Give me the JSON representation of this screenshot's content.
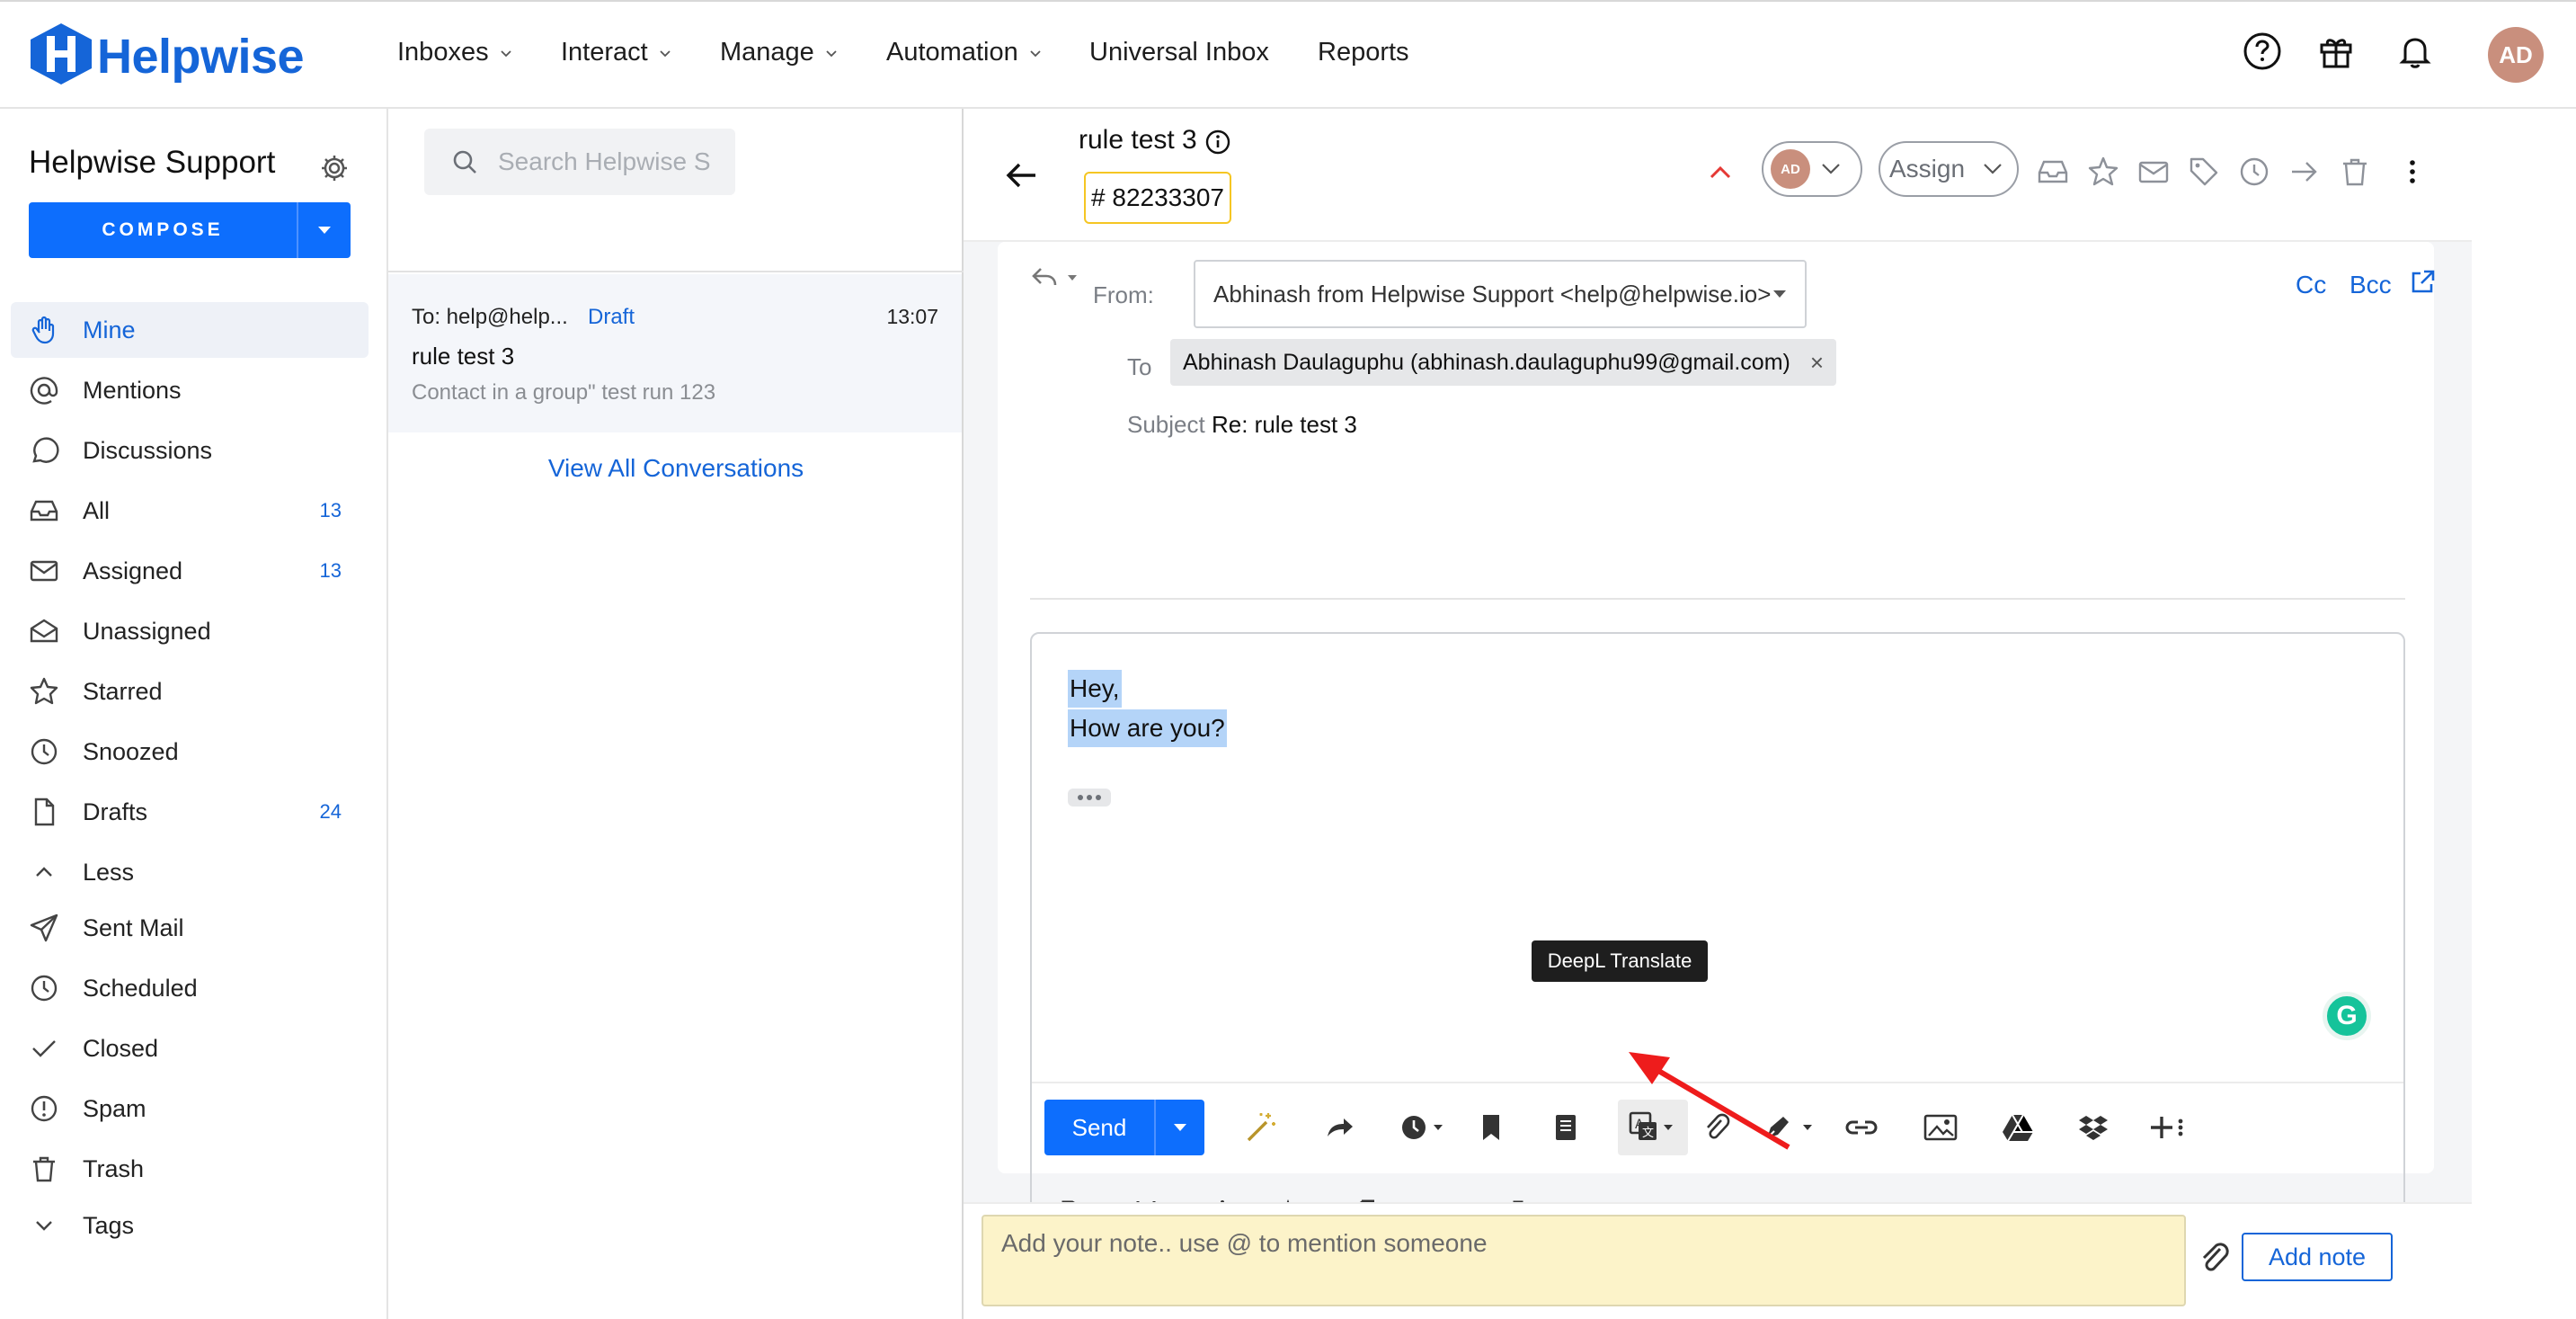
{
  "brand": {
    "name": "Helpwise",
    "accent": "#1565d8",
    "primary_button": "#0d6efd"
  },
  "nav": {
    "items": [
      {
        "label": "Inboxes",
        "dropdown": true
      },
      {
        "label": "Interact",
        "dropdown": true
      },
      {
        "label": "Manage",
        "dropdown": true
      },
      {
        "label": "Automation",
        "dropdown": true
      },
      {
        "label": "Universal Inbox",
        "dropdown": false
      },
      {
        "label": "Reports",
        "dropdown": false
      }
    ],
    "icons": [
      "help-circle-icon",
      "gift-icon",
      "bell-icon"
    ],
    "avatar": "AD"
  },
  "sidebar": {
    "workspace": "Helpwise Support",
    "compose_label": "COMPOSE",
    "items": [
      {
        "label": "Mine",
        "icon": "hand-icon",
        "active": true,
        "count": ""
      },
      {
        "label": "Mentions",
        "icon": "at-icon",
        "count": ""
      },
      {
        "label": "Discussions",
        "icon": "chat-bubble-icon",
        "count": ""
      },
      {
        "label": "All",
        "icon": "inbox-icon",
        "count": "13"
      },
      {
        "label": "Assigned",
        "icon": "envelope-icon",
        "count": "13"
      },
      {
        "label": "Unassigned",
        "icon": "envelope-open-icon",
        "count": ""
      },
      {
        "label": "Starred",
        "icon": "star-icon",
        "count": ""
      },
      {
        "label": "Snoozed",
        "icon": "clock-icon",
        "count": ""
      },
      {
        "label": "Drafts",
        "icon": "file-icon",
        "count": "24"
      },
      {
        "label": "Less",
        "icon": "chevron-up-icon",
        "count": ""
      },
      {
        "label": "Sent Mail",
        "icon": "paper-plane-icon",
        "count": ""
      },
      {
        "label": "Scheduled",
        "icon": "clock-icon",
        "count": ""
      },
      {
        "label": "Closed",
        "icon": "check-icon",
        "count": ""
      },
      {
        "label": "Spam",
        "icon": "alert-circle-icon",
        "count": ""
      },
      {
        "label": "Trash",
        "icon": "trash-icon",
        "count": ""
      },
      {
        "label": "Tags",
        "icon": "chevron-down-icon",
        "count": ""
      }
    ]
  },
  "list": {
    "search_placeholder": "Search Helpwise S",
    "conversation": {
      "to": "To: help@help...",
      "status": "Draft",
      "time": "13:07",
      "subject": "rule test 3",
      "preview": "Contact in a group\" test run 123"
    },
    "view_all": "View All Conversations"
  },
  "conversation": {
    "title": "rule test 3",
    "ticket": "# 82233307",
    "assignee_avatar": "AD",
    "assign_label": "Assign"
  },
  "composer": {
    "from_label": "From:",
    "from_value": "Abhinash from Helpwise Support <help@helpwise.io>",
    "to_label": "To",
    "to_chip": "Abhinash Daulaguphu (abhinash.daulaguphu99@gmail.com)",
    "subject_label": "Subject",
    "subject_value": "Re: rule test 3",
    "cc": "Cc",
    "bcc": "Bcc",
    "body_lines": [
      "Hey,",
      "How are you?"
    ],
    "send_label": "Send",
    "tooltip": "DeepL Translate"
  },
  "note": {
    "placeholder": "Add your note.. use @ to mention someone",
    "add_label": "Add note"
  }
}
